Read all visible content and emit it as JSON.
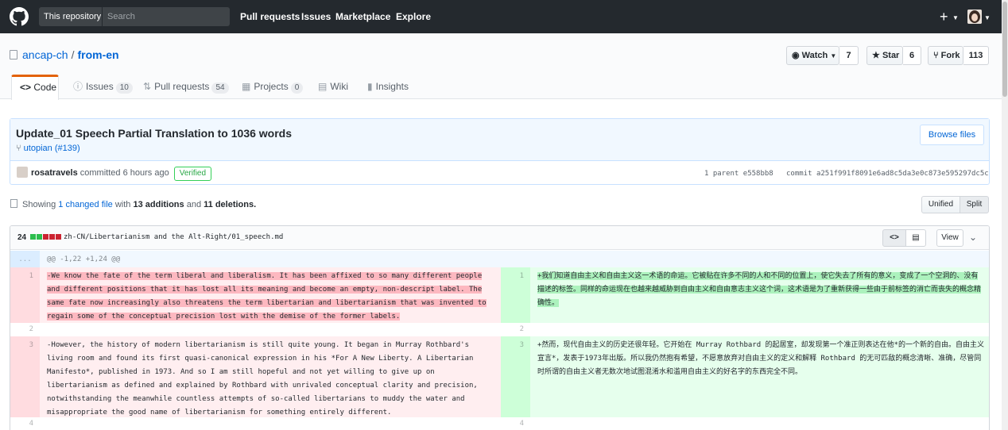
{
  "header": {
    "search_scope": "This repository",
    "search_placeholder": "Search",
    "nav": [
      "Pull requests",
      "Issues",
      "Marketplace",
      "Explore"
    ],
    "plus": "+"
  },
  "repo": {
    "owner": "ancap-ch",
    "separator": "/",
    "name": "from-en",
    "watch_label": "Watch",
    "watch_count": "7",
    "star_label": "Star",
    "star_count": "6",
    "fork_label": "Fork",
    "fork_count": "113"
  },
  "tabs": [
    {
      "label": "Code",
      "badge": null,
      "icon": "<>"
    },
    {
      "label": "Issues",
      "badge": "10",
      "icon": "!"
    },
    {
      "label": "Pull requests",
      "badge": "54",
      "icon": "⇅"
    },
    {
      "label": "Projects",
      "badge": "0",
      "icon": "▦"
    },
    {
      "label": "Wiki",
      "badge": null,
      "icon": "≡"
    },
    {
      "label": "Insights",
      "badge": null,
      "icon": "▮"
    }
  ],
  "commit": {
    "title": "Update_01 Speech Partial Translation to 1036 words",
    "branch": "utopian",
    "pr": "(#139)",
    "browse_label": "Browse files",
    "author": "rosatravels",
    "action": "committed",
    "time": "6 hours ago",
    "verified": "Verified",
    "parent_text": "1 parent",
    "parent_sha": "e558bb8",
    "commit_text": "commit",
    "commit_sha": "a251f991f8091e6ad8c5da3e0c873e595297dc5c"
  },
  "toc": {
    "prefix": "Showing",
    "changed_count": "1",
    "changed_text": "changed file",
    "with": "with",
    "additions": "13 additions",
    "and": "and",
    "deletions": "11 deletions.",
    "unified_label": "Unified",
    "split_label": "Split"
  },
  "file": {
    "stat": "24",
    "path": "zh-CN/Libertarianism and the Alt-Right/01_speech.md",
    "view_label": "View",
    "hunk_marker": "...",
    "hunk_header": "@@ -1,22 +1,24 @@",
    "rows": [
      {
        "left_num": "1",
        "left_text": "-We know the fate of the term liberal and liberalism. It has been affixed to so many different people and different positions that it has lost all its meaning and become an empty, non-descript label. The same fate now increasingly also threatens the term libertarian and libertarianism that was invented to regain some of the conceptual precision lost with the demise of the former labels.",
        "right_num": "1",
        "right_text": "+我们知道自由主义和自由主义这一术语的命运。它被贴在许多不同的人和不同的位置上，使它失去了所有的意义，变成了一个空洞的、没有描述的标签。同样的命运现在也越来越威胁到自由主义和自由意志主义这个词，这术语是为了重新获得一些由于前标签的消亡而丧失的概念精确性。"
      },
      {
        "left_num": "2",
        "left_text": "",
        "right_num": "2",
        "right_text": ""
      },
      {
        "left_num": "3",
        "left_text": "-However, the history of modern libertarianism is still quite young. It began in Murray Rothbard's living room and found its first quasi-canonical expression in his *For A New Liberty. A Libertarian Manifesto*, published in 1973. And so I am still hopeful and not yet willing to give up on libertarianism as defined and explained by Rothbard with unrivaled conceptual clarity and precision, notwithstanding the meanwhile countless attempts of so-called libertarians to muddy the water and misappropriate the good name of libertarianism for something entirely different.",
        "right_num": "3",
        "right_text": "+然而，现代自由主义的历史还很年轻。它开始在 Murray Rothbard 的起居室，却发现第一个准正则表达在他*的一个新的自由。自由主义宣言*，发表于1973年出版。所以我仍然抱有希望，不愿意放弃对自由主义的定义和解释 Rothbard 的无可匹敌的概念清晰、准确，尽管同时所谓的自由主义者无数次地试图混淆水和滥用自由主义的好名字的东西完全不同。"
      },
      {
        "left_num": "4",
        "left_text": "",
        "right_num": "4",
        "right_text": ""
      }
    ]
  },
  "colors": {
    "header_bg": "#24292e",
    "link": "#0366d6",
    "deletion_bg": "#ffeef0",
    "deletion_num_bg": "#ffdce0",
    "addition_bg": "#e6ffed",
    "addition_num_bg": "#cdffd8",
    "hunk_bg": "#f1f8ff",
    "tab_accent": "#e36209"
  }
}
